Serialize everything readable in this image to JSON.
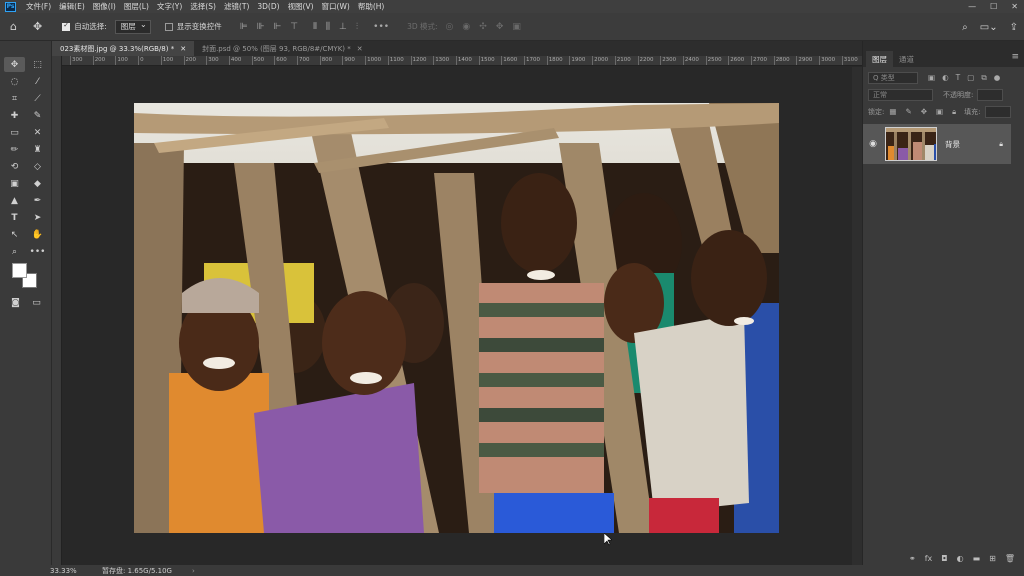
{
  "menubar": {
    "logo": "Ps",
    "items": [
      "文件(F)",
      "编辑(E)",
      "图像(I)",
      "图层(L)",
      "文字(Y)",
      "选择(S)",
      "滤镜(T)",
      "3D(D)",
      "视图(V)",
      "窗口(W)",
      "帮助(H)"
    ],
    "window_controls": [
      "—",
      "☐",
      "✕"
    ]
  },
  "options": {
    "auto_select_label": "自动选择:",
    "auto_select_value": "图层",
    "show_transform_label": "显示变换控件",
    "mode_label": "3D 模式:"
  },
  "tabs": [
    {
      "label": "023素材图.jpg @ 33.3%(RGB/8) *",
      "active": true
    },
    {
      "label": "封面.psd @ 50% (图层 93, RGB/8#/CMYK) *",
      "active": false
    }
  ],
  "ruler": {
    "ticks": [
      "300",
      "200",
      "100",
      "0",
      "100",
      "200",
      "300",
      "400",
      "500",
      "600",
      "700",
      "800",
      "900",
      "1000",
      "1100",
      "1200",
      "1300",
      "1400",
      "1500",
      "1600",
      "1700",
      "1800",
      "1900",
      "2000",
      "2100",
      "2200",
      "2300",
      "2400",
      "2500",
      "2600",
      "2700",
      "2800",
      "2900",
      "3000",
      "3100",
      "3200"
    ]
  },
  "status": {
    "zoom": "33.33%",
    "info": "暂存盘: 1.65G/5.10G",
    "arrow": "›"
  },
  "panel": {
    "tabs": [
      "图层",
      "通道"
    ],
    "filter_placeholder": "Q 类型",
    "blend_mode": "正常",
    "opacity_label": "不透明度:",
    "lock_label": "锁定:",
    "fill_label": "填充:",
    "layer_name": "背景"
  },
  "colors": {
    "accent": "#2fa3f5",
    "foreground": "#ffffff",
    "background": "#ffffff"
  }
}
